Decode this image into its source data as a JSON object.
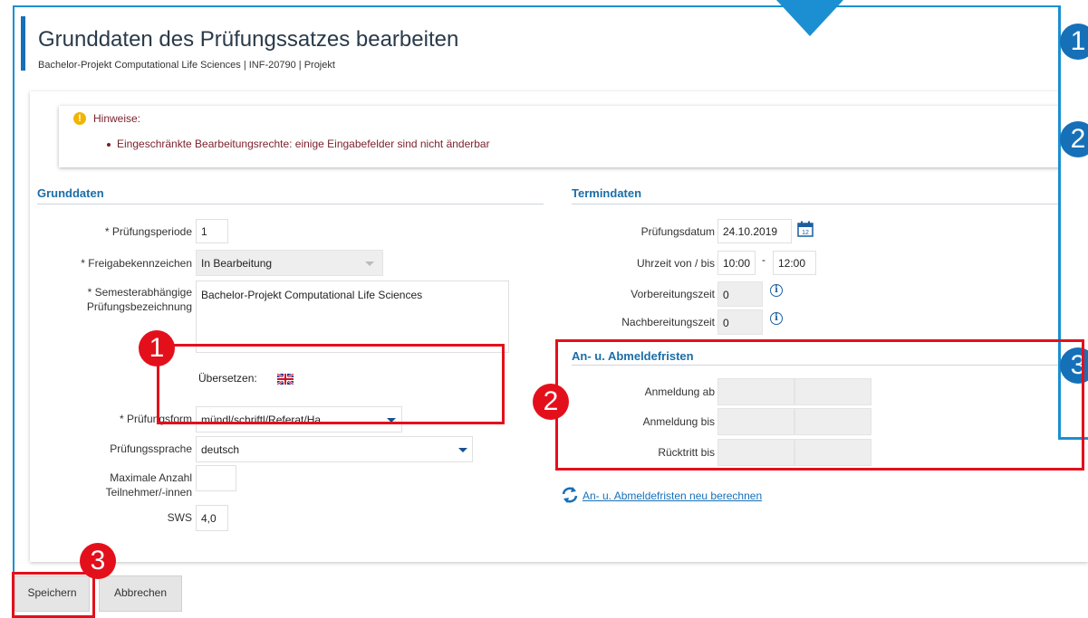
{
  "header": {
    "title": "Grunddaten des Prüfungssatzes bearbeiten",
    "breadcrumb": "Bachelor-Projekt Computational Life Sciences | INF-20790 | Projekt"
  },
  "hints": {
    "title": "Hinweise:",
    "items": [
      "Eingeschränkte Bearbeitungsrechte: einige Eingabefelder sind nicht änderbar"
    ]
  },
  "grunddaten": {
    "heading": "Grunddaten",
    "pruefungsperiode_label": "* Prüfungsperiode",
    "pruefungsperiode_value": "1",
    "freigabe_label": "* Freigabekennzeichen",
    "freigabe_value": "In Bearbeitung",
    "bezeichnung_label_1": "* Semesterabhängige",
    "bezeichnung_label_2": "Prüfungsbezeichnung",
    "bezeichnung_value": "Bachelor-Projekt Computational Life Sciences",
    "uebersetzen_label": "Übersetzen:",
    "form_label": "* Prüfungsform",
    "form_value": "mündl/schriftl/Referat/Ha",
    "sprache_label": "Prüfungssprache",
    "sprache_value": "deutsch",
    "max_label_1": "Maximale Anzahl",
    "max_label_2": "Teilnehmer/-innen",
    "max_value": "",
    "sws_label": "SWS",
    "sws_value": "4,0"
  },
  "termindaten": {
    "heading": "Termindaten",
    "datum_label": "Prüfungsdatum",
    "datum_value": "24.10.2019",
    "uhrzeit_label": "Uhrzeit von / bis",
    "uhrzeit_von": "10:00",
    "uhrzeit_sep": "-",
    "uhrzeit_bis": "12:00",
    "vorbereitung_label": "Vorbereitungszeit",
    "vorbereitung_value": "0",
    "nachbereitung_label": "Nachbereitungszeit",
    "nachbereitung_value": "0"
  },
  "fristen": {
    "heading": "An- u. Abmeldefristen",
    "anmeldung_ab_label": "Anmeldung ab",
    "anmeldung_bis_label": "Anmeldung bis",
    "ruecktritt_label": "Rücktritt bis",
    "recalc_link": "An- u. Abmeldefristen neu berechnen"
  },
  "buttons": {
    "save": "Speichern",
    "cancel": "Abbrechen"
  },
  "badges": [
    "1",
    "2",
    "3"
  ],
  "side_badges": [
    "1",
    "2",
    "3"
  ],
  "colors": {
    "accent_blue": "#1b8fd1",
    "highlight_red": "#e3101b",
    "hint_text": "#7a1f2a"
  }
}
